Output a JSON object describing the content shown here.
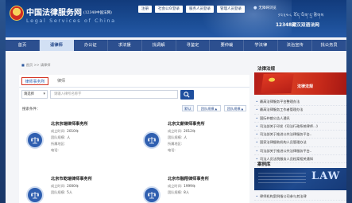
{
  "header": {
    "site_title": "中国法律服务网",
    "site_title_hot": "(12348中国法网)",
    "site_en": "Legal Services of China",
    "top_links": [
      "注册",
      "社会公众登录",
      "服务人员登录",
      "管理人员登录"
    ],
    "accessibility": "无障碍浏览",
    "tibetan": "༡༢༣༤༨ བོད་ཡིག་དྲ་ཚིགས",
    "hotline": "12348藏汉双语法网"
  },
  "nav": {
    "items": [
      "首页",
      "请律师",
      "办公证",
      "求法援",
      "找调解",
      "寻鉴定",
      "要仲裁",
      "学法律",
      "法治宣传",
      "找公务员"
    ],
    "active_index": 1
  },
  "breadcrumb": "首页 >> 请律师",
  "main": {
    "tabs": [
      "律师事务所",
      "律师"
    ],
    "active_tab": 0,
    "select_value": "请选择",
    "search_placeholder": "请输入律所名称字",
    "filter_label": "搜索条件：",
    "sort_default": "默认",
    "sort_size": "团队规模",
    "sort_scale": "团队规模",
    "cards": [
      {
        "name": "北京京瑞律师事务所",
        "rows": [
          [
            "成立时间:",
            "2010年"
          ],
          [
            "团队规模:",
            "人"
          ],
          [
            "所属地区:",
            ""
          ],
          [
            "电话:",
            ""
          ]
        ]
      },
      {
        "name": "北京文薪律师事务所",
        "rows": [
          [
            "成立时间:",
            "2012年"
          ],
          [
            "团队规模:",
            "人"
          ],
          [
            "所属地区:",
            ""
          ],
          [
            "电话:",
            ""
          ]
        ]
      },
      {
        "name": "北京市乾瑞律师事务所",
        "rows": [
          [
            "成立时间:",
            "2000年"
          ],
          [
            "团队规模:",
            "5人"
          ]
        ]
      },
      {
        "name": "北京市融翔律师事务所",
        "rows": [
          [
            "成立时间:",
            "1999年"
          ],
          [
            "团队规模:",
            "8人"
          ]
        ]
      }
    ]
  },
  "sidebar": {
    "heading_law": "法律法规",
    "banner_text": "法律法规",
    "news": [
      "最高法律服务平台整理办法",
      "最高法律服务工作者管理办法",
      "国际仲裁公告人通讯",
      "司法部关于印发《司法行政系统律师...》",
      "司法部关于推进公共法律服务平台..",
      "国家法律援助机构人员管理办法",
      "司法部关于推进公共法律服务平台..",
      "司法人员法院服务人员档案相关通知"
    ],
    "heading_case": "案例库",
    "case_img_text": "LAW",
    "case_news": [
      "律师机构案例指公司参与其法律"
    ]
  }
}
